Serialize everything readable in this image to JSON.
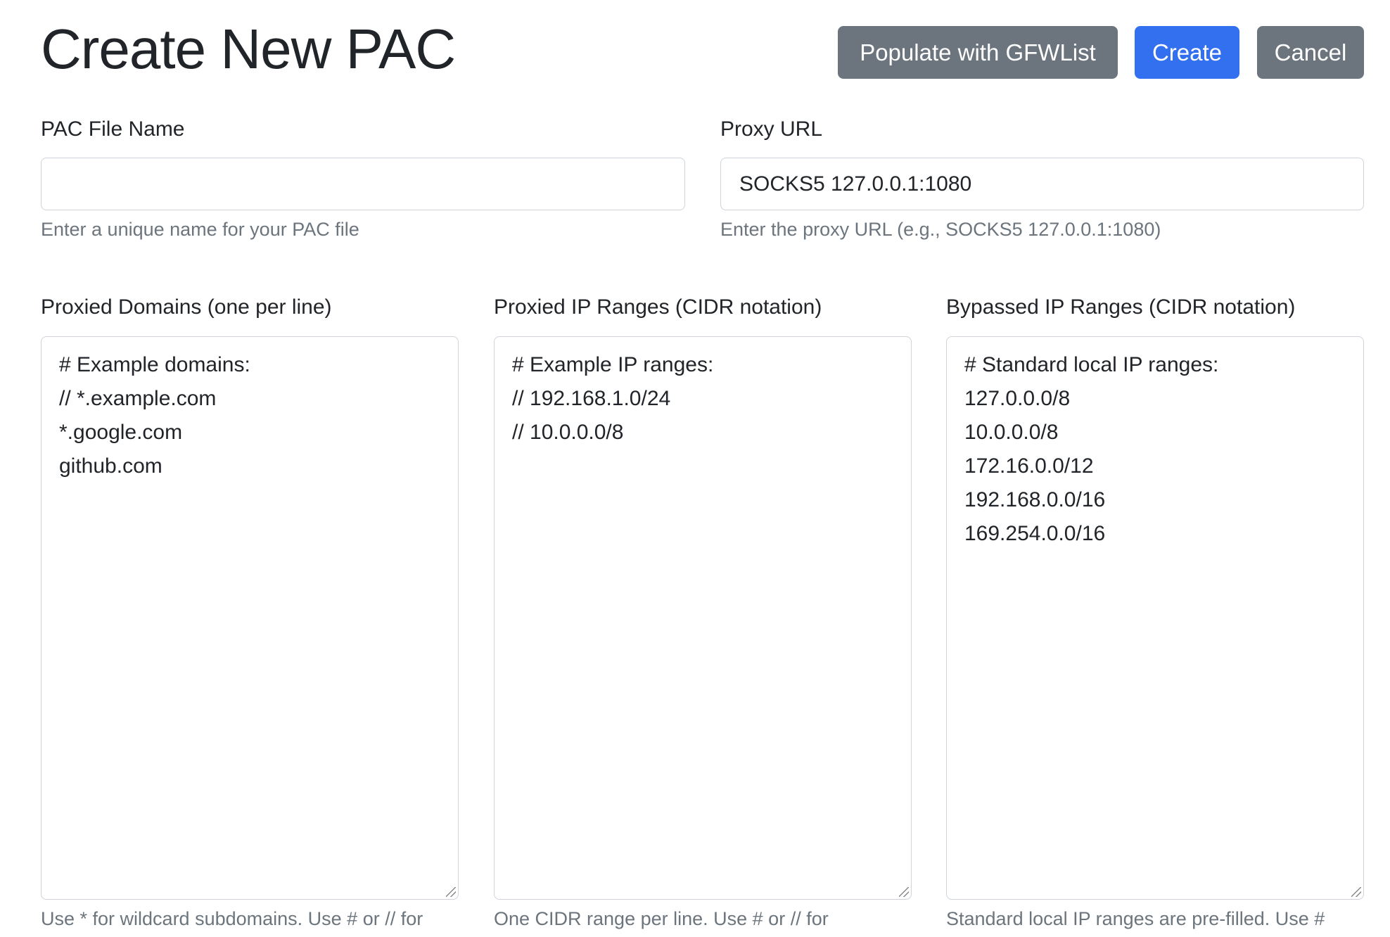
{
  "page_title": "Create New PAC",
  "actions": {
    "populate": "Populate with GFWList",
    "create": "Create",
    "cancel": "Cancel"
  },
  "colors": {
    "primary": "#3270f0",
    "secondary": "#6c757d"
  },
  "fields": {
    "name": {
      "label": "PAC File Name",
      "value": "",
      "help": "Enter a unique name for your PAC file"
    },
    "proxy": {
      "label": "Proxy URL",
      "value": "SOCKS5 127.0.0.1:1080",
      "help": "Enter the proxy URL (e.g., SOCKS5 127.0.0.1:1080)"
    }
  },
  "textareas": {
    "domains": {
      "label": "Proxied Domains (one per line)",
      "lines": [
        "# Example domains:",
        "// *.example.com",
        "*.google.com",
        "github.com"
      ],
      "help": "Use * for wildcard subdomains. Use # or // for"
    },
    "proxied_ips": {
      "label": "Proxied IP Ranges (CIDR notation)",
      "lines": [
        "# Example IP ranges:",
        "// 192.168.1.0/24",
        "// 10.0.0.0/8"
      ],
      "help": "One CIDR range per line. Use # or // for"
    },
    "bypassed_ips": {
      "label": "Bypassed IP Ranges (CIDR notation)",
      "lines": [
        "# Standard local IP ranges:",
        "127.0.0.0/8",
        "10.0.0.0/8",
        "172.16.0.0/12",
        "192.168.0.0/16",
        "169.254.0.0/16"
      ],
      "help": "Standard local IP ranges are pre-filled. Use #"
    }
  }
}
